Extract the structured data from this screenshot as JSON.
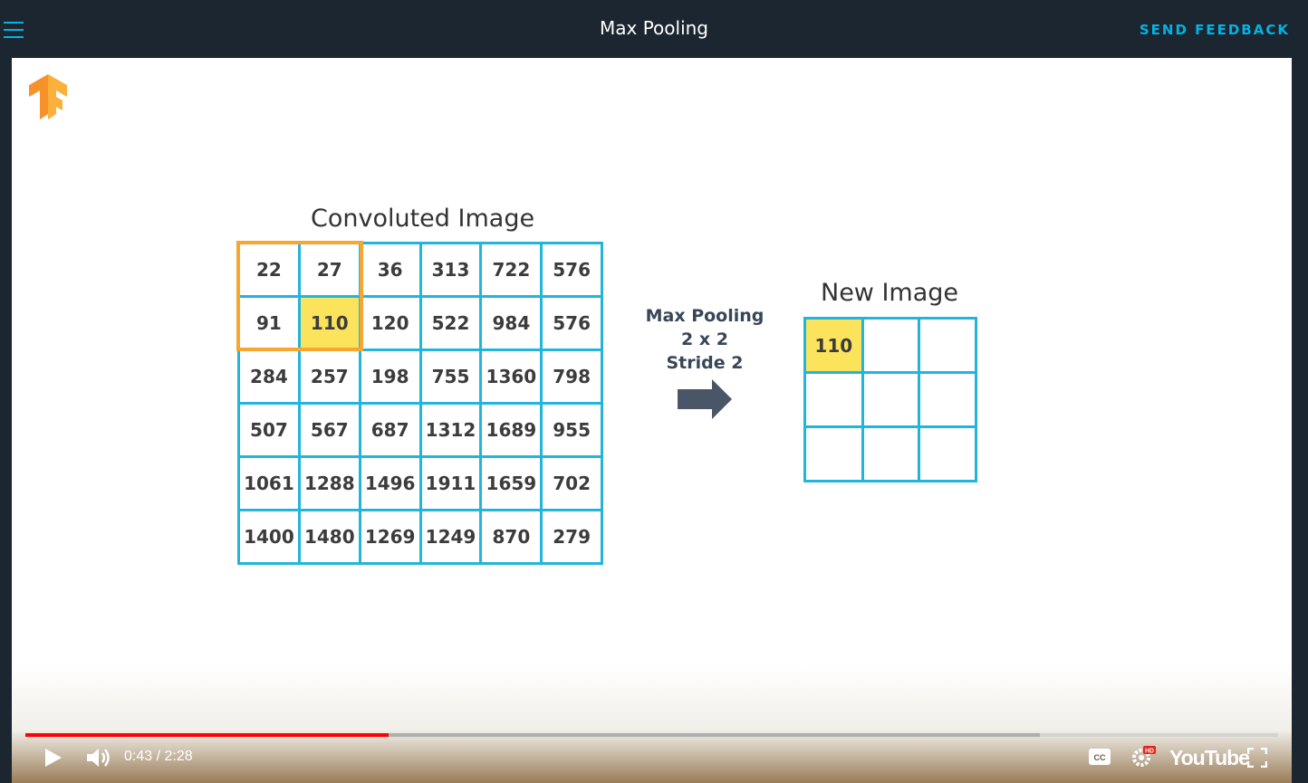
{
  "header": {
    "title": "Max Pooling",
    "feedback_label": "SEND FEEDBACK"
  },
  "slide": {
    "convoluted_title": "Convoluted Image",
    "new_title": "New Image",
    "pooling_label": [
      "Max Pooling",
      "2 x 2",
      "Stride 2"
    ],
    "convoluted_grid": [
      [
        "22",
        "27",
        "36",
        "313",
        "722",
        "576"
      ],
      [
        "91",
        "110",
        "120",
        "522",
        "984",
        "576"
      ],
      [
        "284",
        "257",
        "198",
        "755",
        "1360",
        "798"
      ],
      [
        "507",
        "567",
        "687",
        "1312",
        "1689",
        "955"
      ],
      [
        "1061",
        "1288",
        "1496",
        "1911",
        "1659",
        "702"
      ],
      [
        "1400",
        "1480",
        "1269",
        "1249",
        "870",
        "279"
      ]
    ],
    "new_grid": [
      [
        "110",
        "",
        ""
      ],
      [
        "",
        "",
        ""
      ],
      [
        "",
        "",
        ""
      ]
    ],
    "colors": {
      "grid_border": "#22b5dc",
      "highlight": "#fbe35b",
      "pool_window": "#f7a731",
      "arrow": "#4a5568"
    }
  },
  "player": {
    "current_time": "0:43",
    "duration": "2:28",
    "time_display": "0:43 / 2:28",
    "played_fraction": 0.29,
    "buffered_fraction": 0.81,
    "brand": "YouTube",
    "hd_badge": "HD",
    "cc_label": "CC",
    "progress_color": "#ff0000"
  }
}
